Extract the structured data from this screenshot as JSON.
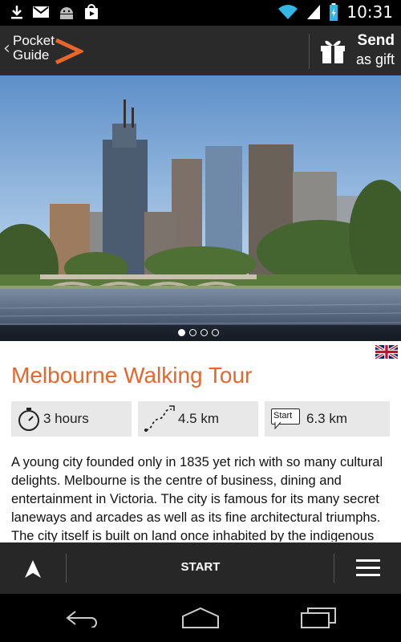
{
  "status_bar": {
    "time": "10:31",
    "icons": [
      "download-icon",
      "gmail-icon",
      "android-icon",
      "play-store-icon",
      "wifi-icon",
      "signal-icon",
      "battery-charging-icon"
    ]
  },
  "app_bar": {
    "logo_line1": "Pocket",
    "logo_line2": "Guide",
    "send_line1": "Send",
    "send_line2": "as gift"
  },
  "carousel": {
    "page_count": 4,
    "current_page": 1
  },
  "tour": {
    "language_flag": "uk-flag-icon",
    "title": "Melbourne Walking Tour",
    "duration": "3 hours",
    "walking_distance": "4.5 km",
    "start_badge": "Start",
    "start_distance": "6.3 km",
    "description": "A young city founded only in 1835 yet rich with so many cultural delights. Melbourne is the centre of business, dining and entertainment in Victoria. The city is famous for its many secret laneways and arcades as well as its fine architectural triumphs. The city itself is built on land once inhabited by the indigenous Australian tribes of the"
  },
  "bottom_bar": {
    "start_label": "START"
  },
  "colors": {
    "accent": "#e8662b",
    "bar_dark": "#2a2a2a",
    "stat_bg": "#e8e8e8"
  }
}
